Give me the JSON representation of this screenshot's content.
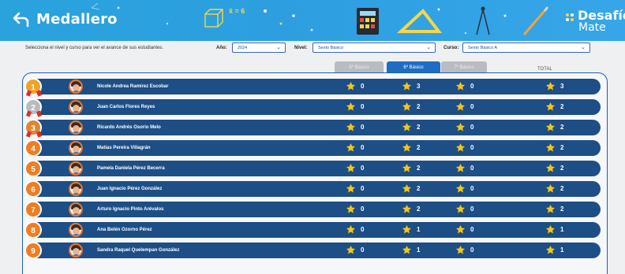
{
  "header": {
    "title": "Medallero",
    "brand_line1": "Desafío",
    "brand_line2": "Mate",
    "back_icon": "arrow-back-icon",
    "deco_symbols": "x̄ = 6"
  },
  "filters": {
    "hint": "Selecciona el nivel y curso para ver el avance de sus estudiantes.",
    "year": {
      "label": "Año:",
      "value": "2024"
    },
    "level": {
      "label": "Nivel:",
      "value": "Sexto Básico"
    },
    "course": {
      "label": "Curso:",
      "value": "Sexto Básico A"
    }
  },
  "columns": {
    "tabs": [
      "5º Básico",
      "6º Básico",
      "7º Básico"
    ],
    "active_tab": 1,
    "total_label": "TOTAL"
  },
  "colors": {
    "header": "#2d9fe0",
    "row": "#1d4e86",
    "medal_gold": "#f0a32a",
    "medal_silver": "#b8bcc2",
    "medal_bronze": "#e0862c",
    "medal_default": "#f07d22",
    "star": "#f5c518"
  },
  "rows": [
    {
      "rank": "1",
      "name": "Nicole Andrea Ramírez Escobar",
      "s5": "0",
      "s6": "3",
      "s7": "0",
      "total": "3",
      "medal": "gold"
    },
    {
      "rank": "2",
      "name": "Juan Carlos Flores Reyes",
      "s5": "0",
      "s6": "2",
      "s7": "0",
      "total": "2",
      "medal": "silver"
    },
    {
      "rank": "3",
      "name": "Ricardo Andrés Osorio Melo",
      "s5": "0",
      "s6": "2",
      "s7": "0",
      "total": "2",
      "medal": "bronze"
    },
    {
      "rank": "4",
      "name": "Matías Pereira Villagrán",
      "s5": "0",
      "s6": "2",
      "s7": "0",
      "total": "2",
      "medal": "default"
    },
    {
      "rank": "5",
      "name": "Pamela Daniela Pérez Becerra",
      "s5": "0",
      "s6": "2",
      "s7": "0",
      "total": "2",
      "medal": "default"
    },
    {
      "rank": "6",
      "name": "Juan Ignacio Pérez González",
      "s5": "0",
      "s6": "2",
      "s7": "0",
      "total": "2",
      "medal": "default"
    },
    {
      "rank": "7",
      "name": "Arturo Ignacio Pinto Arévalos",
      "s5": "0",
      "s6": "2",
      "s7": "0",
      "total": "2",
      "medal": "default"
    },
    {
      "rank": "8",
      "name": "Ana Belén Ozorno Pérez",
      "s5": "0",
      "s6": "1",
      "s7": "0",
      "total": "1",
      "medal": "default"
    },
    {
      "rank": "9",
      "name": "Sandra Raquel Quelempan González",
      "s5": "0",
      "s6": "1",
      "s7": "0",
      "total": "1",
      "medal": "default"
    }
  ]
}
